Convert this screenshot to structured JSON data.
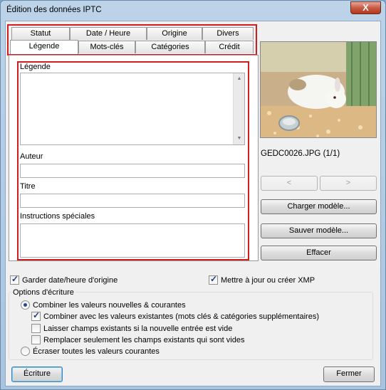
{
  "window": {
    "title": "Édition des données IPTC",
    "close_symbol": "X"
  },
  "tabs": {
    "row1": [
      "Statut",
      "Date / Heure",
      "Origine",
      "Divers"
    ],
    "row2": [
      "Légende",
      "Mots-clés",
      "Catégories",
      "Crédit"
    ],
    "active": "Légende"
  },
  "caption_tab": {
    "legende_label": "Légende",
    "legende_value": "",
    "auteur_label": "Auteur",
    "auteur_value": "",
    "titre_label": "Titre",
    "titre_value": "",
    "instructions_label": "Instructions spéciales",
    "instructions_value": ""
  },
  "preview": {
    "filename": "GEDC0026.JPG (1/1)",
    "prev_label": "<",
    "next_label": ">"
  },
  "side_buttons": {
    "load": "Charger modèle...",
    "save": "Sauver modèle...",
    "clear": "Effacer"
  },
  "options": {
    "keep_date": {
      "label": "Garder date/heure d'origine",
      "checked": true
    },
    "update_xmp": {
      "label": "Mettre à jour ou créer XMP",
      "checked": true
    },
    "group_title": "Options d'écriture",
    "combine_new": {
      "label": "Combiner les valeurs nouvelles & courantes",
      "selected": true
    },
    "combine_existing": {
      "label": "Combiner avec les valeurs existantes (mots clés & catégories supplémentaires)",
      "checked": true
    },
    "leave_existing": {
      "label": "Laisser champs existants si la nouvelle entrée est vide",
      "checked": false
    },
    "replace_only": {
      "label": "Remplacer seulement les champs existants qui sont vides",
      "checked": false
    },
    "overwrite_all": {
      "label": "Écraser toutes les valeurs courantes",
      "selected": false
    }
  },
  "footer": {
    "write": "Écriture",
    "close": "Fermer"
  }
}
